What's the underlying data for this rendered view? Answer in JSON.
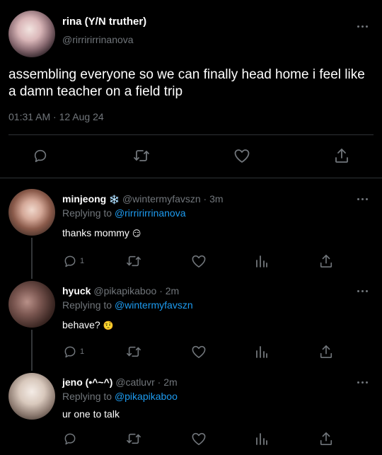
{
  "main": {
    "author_name": "rina (Y/N truther)",
    "author_handle": "@rirririrrinanova",
    "text_line1": "assembling everyone so we can finally head home i feel like",
    "text_line2": "a damn teacher on a field trip",
    "time": "01:31 AM",
    "date": "12 Aug 24",
    "separator": "·"
  },
  "replies": [
    {
      "name": "minjeong",
      "name_badge": "❄️",
      "handle": "@wintermyfavszn",
      "age": "3m",
      "replying_label": "Replying to",
      "replying_handle": "@rirririrrinanova",
      "text": "thanks mommy",
      "emoji": "😏",
      "reply_count": "1"
    },
    {
      "name": "hyuck",
      "name_badge": "",
      "handle": "@pikapikaboo",
      "age": "2m",
      "replying_label": "Replying to",
      "replying_handle": "@wintermyfavszn",
      "text": "behave?",
      "emoji": "🤨",
      "reply_count": "1"
    },
    {
      "name": "jeno (•^~^)",
      "name_badge": "",
      "handle": "@catluvr",
      "age": "2m",
      "replying_label": "Replying to",
      "replying_handle": "@pikapikaboo",
      "text": "ur one to talk",
      "emoji": "",
      "reply_count": ""
    }
  ],
  "icons": {
    "reply": "reply-icon",
    "retweet": "retweet-icon",
    "like": "like-icon",
    "share": "share-icon",
    "views": "views-icon",
    "more": "more-icon"
  },
  "colors": {
    "background": "#000000",
    "text": "#ffffff",
    "muted": "#71767b",
    "link": "#1d9bf0",
    "divider": "#2f3336"
  }
}
